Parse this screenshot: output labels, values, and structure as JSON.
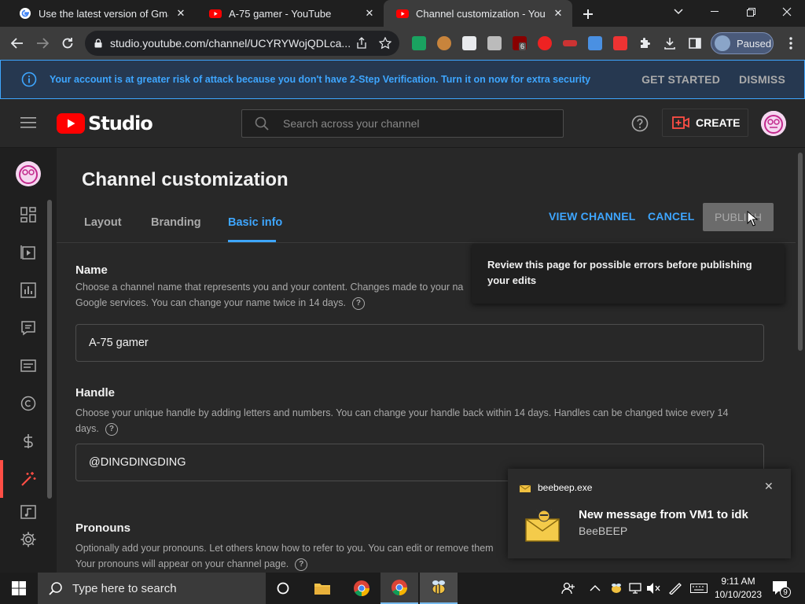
{
  "browser": {
    "tabs": [
      {
        "title": "Use the latest version of Gmail in",
        "favicon": "google-g"
      },
      {
        "title": "A-75 gamer - YouTube",
        "favicon": "youtube"
      },
      {
        "title": "Channel customization - YouTube",
        "favicon": "youtube",
        "active": true
      }
    ],
    "url": "studio.youtube.com/channel/UCYRYWojQDLca...",
    "extension_badge": "6",
    "profile_label": "Paused"
  },
  "banner": {
    "message": "Your account is at greater risk of attack because you don't have 2-Step Verification. Turn it on now for extra security",
    "get_started": "GET STARTED",
    "dismiss": "DISMISS"
  },
  "header": {
    "logo_text": "Studio",
    "search_placeholder": "Search across your channel",
    "create_label": "CREATE"
  },
  "page": {
    "title": "Channel customization",
    "tabs": [
      "Layout",
      "Branding",
      "Basic info"
    ],
    "active_tab": "Basic info",
    "view_channel": "VIEW CHANNEL",
    "cancel": "CANCEL",
    "publish": "PUBLISH",
    "tooltip": "Review this page for possible errors before publishing your edits"
  },
  "name_section": {
    "title": "Name",
    "desc_line1": "Choose a channel name that represents you and your content. Changes made to your na",
    "desc_line2": "Google services. You can change your name twice in 14 days.",
    "value": "A-75 gamer"
  },
  "handle_section": {
    "title": "Handle",
    "desc_line1": "Choose your unique handle by adding letters and numbers. You can change your handle back within 14 days. Handles can be changed twice every 14",
    "desc_line2": "days.",
    "value": "@DINGDINGDING"
  },
  "pronouns_section": {
    "title": "Pronouns",
    "desc_line1": "Optionally add your pronouns. Let others know how to refer to you. You can edit or remove them",
    "desc_line2": "Your pronouns will appear on your channel page."
  },
  "notification": {
    "app": "beebeep.exe",
    "title": "New message from VM1 to idk",
    "source": "BeeBEEP"
  },
  "taskbar": {
    "search_placeholder": "Type here to search",
    "time": "9:11 AM",
    "date": "10/10/2023",
    "notification_count": "9"
  },
  "colors": {
    "accent": "#3ea6ff",
    "youtube_red": "#ff0000",
    "studio_active": "#ff4e45"
  }
}
